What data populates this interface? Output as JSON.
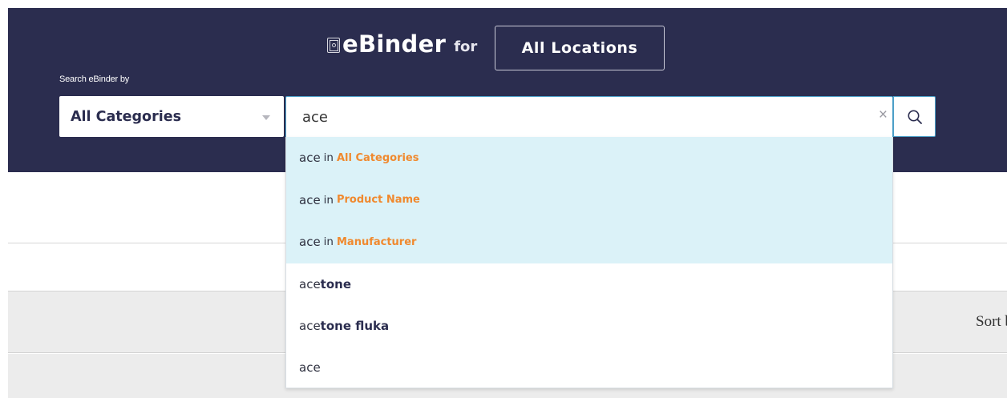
{
  "header": {
    "brand_name": "eBinder",
    "brand_for": "for",
    "location_button": "All Locations",
    "search_label": "Search eBinder by"
  },
  "search": {
    "category_value": "All Categories",
    "query": "ace",
    "clear_symbol": "×"
  },
  "suggestions": {
    "category_items": [
      {
        "query": "ace",
        "connector": "in",
        "category": "All Categories"
      },
      {
        "query": "ace",
        "connector": "in",
        "category": "Product Name"
      },
      {
        "query": "ace",
        "connector": "in",
        "category": "Manufacturer"
      }
    ],
    "text_items": [
      {
        "prefix": "ace",
        "completion": "tone"
      },
      {
        "prefix": "ace",
        "completion": "tone fluka"
      },
      {
        "prefix": "ace",
        "completion": ""
      }
    ]
  },
  "results": {
    "sort_label": "Sort b"
  },
  "colors": {
    "header_bg": "#2b2d4f",
    "highlight_bg": "#dbf2f8",
    "category_accent": "#f0892e",
    "focus_border": "#4b9fc8"
  },
  "icons": {
    "brand": "binder-icon",
    "search": "search-icon",
    "clear": "close-icon",
    "select": "chevron-down-icon"
  }
}
